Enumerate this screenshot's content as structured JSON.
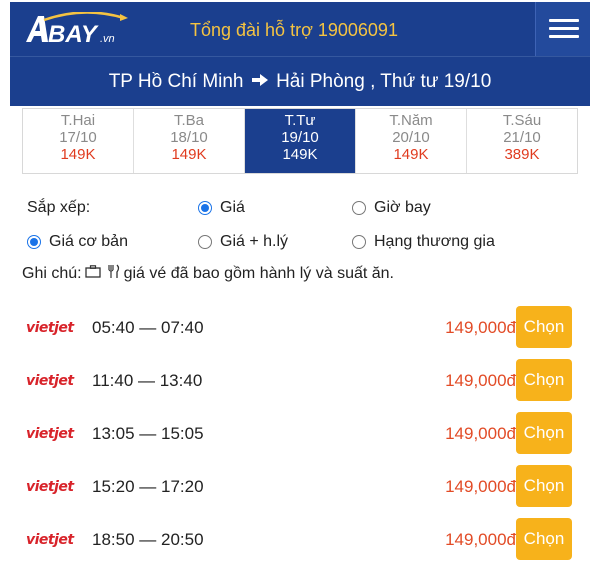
{
  "header": {
    "logo_text": "BAY",
    "logo_sub": ".vn",
    "hotline": "Tổng đài hỗ trợ 19006091",
    "menu_icon": "hamburger-icon"
  },
  "route": {
    "origin": "TP Hồ Chí Minh",
    "arrow_icon": "arrow-right-icon",
    "destination": "Hải Phòng",
    "date": ", Thứ tư 19/10"
  },
  "days": [
    {
      "name": "T.Hai",
      "date": "17/10",
      "price": "149K"
    },
    {
      "name": "T.Ba",
      "date": "18/10",
      "price": "149K"
    },
    {
      "name": "T.Tư",
      "date": "19/10",
      "price": "149K"
    },
    {
      "name": "T.Năm",
      "date": "20/10",
      "price": "149K"
    },
    {
      "name": "T.Sáu",
      "date": "21/10",
      "price": "389K"
    }
  ],
  "sort": {
    "label": "Sắp xếp:",
    "by_price": "Giá",
    "by_time": "Giờ bay",
    "base_fare": "Giá cơ bản",
    "fare_baggage": "Giá + h.lý",
    "business": "Hạng thương gia"
  },
  "note": {
    "prefix": "Ghi chú:",
    "icons": [
      "suitcase-icon",
      "meal-icon"
    ],
    "text": "giá vé đã bao gồm hành lý và suất ăn."
  },
  "flights": [
    {
      "airline": "vietjet",
      "time": "05:40 — 07:40",
      "price": "149,000đ",
      "button": "Chọn"
    },
    {
      "airline": "vietjet",
      "time": "11:40 — 13:40",
      "price": "149,000đ",
      "button": "Chọn"
    },
    {
      "airline": "vietjet",
      "time": "13:05 — 15:05",
      "price": "149,000đ",
      "button": "Chọn"
    },
    {
      "airline": "vietjet",
      "time": "15:20 — 17:20",
      "price": "149,000đ",
      "button": "Chọn"
    },
    {
      "airline": "vietjet",
      "time": "18:50 — 20:50",
      "price": "149,000đ",
      "button": "Chọn"
    }
  ],
  "colors": {
    "header_bg": "#1b3f8e",
    "hotline": "#f4c342",
    "price": "#e24b26",
    "button": "#f7b21b",
    "airline": "#d8232a"
  }
}
